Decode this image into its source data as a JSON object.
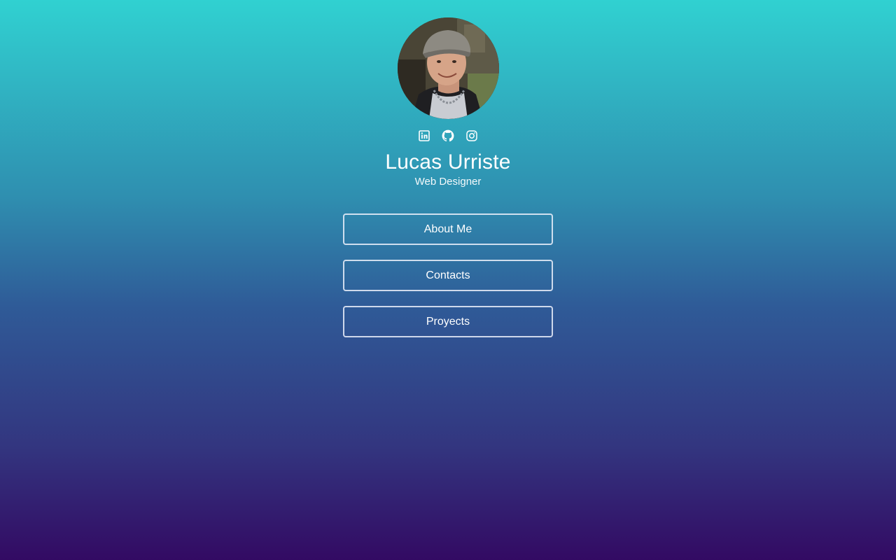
{
  "profile": {
    "name": "Lucas Urriste",
    "role": "Web Designer",
    "avatar_icon": "profile-photo"
  },
  "socials": [
    {
      "icon": "linkedin-icon"
    },
    {
      "icon": "github-icon"
    },
    {
      "icon": "instagram-icon"
    }
  ],
  "menu": {
    "about_label": "About Me",
    "contacts_label": "Contacts",
    "projects_label": "Proyects"
  },
  "colors": {
    "gradient_top": "#30d1d1",
    "gradient_bottom": "#330a63",
    "text": "#ffffff"
  }
}
